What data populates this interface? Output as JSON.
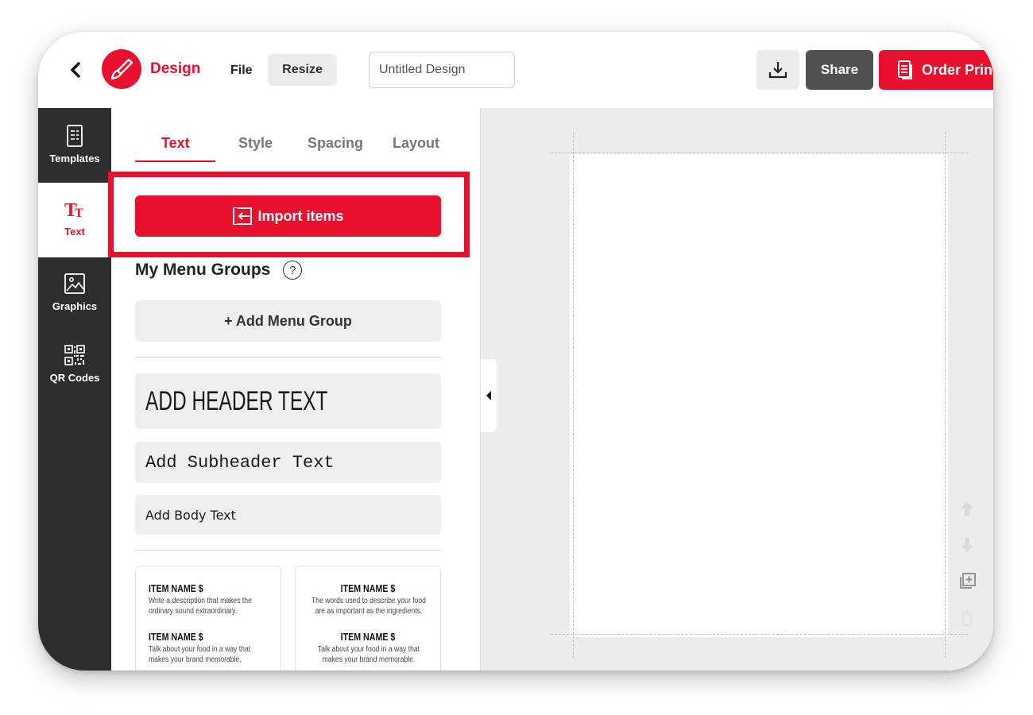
{
  "header": {
    "brand": "Design",
    "file_label": "File",
    "resize_label": "Resize",
    "title_value": "Untitled Design",
    "share_label": "Share",
    "order_label": "Order Prints"
  },
  "rail": {
    "items": [
      {
        "label": "Templates",
        "icon": "templates-icon"
      },
      {
        "label": "Text",
        "icon": "text-icon"
      },
      {
        "label": "Graphics",
        "icon": "image-icon"
      },
      {
        "label": "QR Codes",
        "icon": "qr-code-icon"
      }
    ],
    "active": "Text"
  },
  "panel": {
    "tabs": [
      {
        "label": "Text",
        "active": true
      },
      {
        "label": "Style",
        "active": false
      },
      {
        "label": "Spacing",
        "active": false
      },
      {
        "label": "Layout",
        "active": false
      }
    ],
    "import_label": "Import items",
    "groups_title": "My Menu Groups",
    "help_glyph": "?",
    "add_group_label": "+ Add Menu Group",
    "header_text": "ADD HEADER TEXT",
    "subheader_text": "Add Subheader Text",
    "body_text": "Add Body Text",
    "cards": [
      {
        "item1_name": "ITEM NAME $",
        "item1_desc": "Write a description that makes the ordinary sound extraordinary.",
        "item2_name": "ITEM NAME $",
        "item2_desc": "Talk about your food in a way that makes your brand memorable."
      },
      {
        "item1_name": "ITEM NAME $",
        "item1_desc": "The words used to describe your food are as important as the ingredients.",
        "item2_name": "ITEM NAME $",
        "item2_desc": "Talk about your food in a way that makes your brand memorable."
      }
    ]
  },
  "colors": {
    "accent": "#e8102d",
    "rail_bg": "#2e2e2e",
    "canvas_bg": "#ececec",
    "share_bg": "#515151"
  }
}
